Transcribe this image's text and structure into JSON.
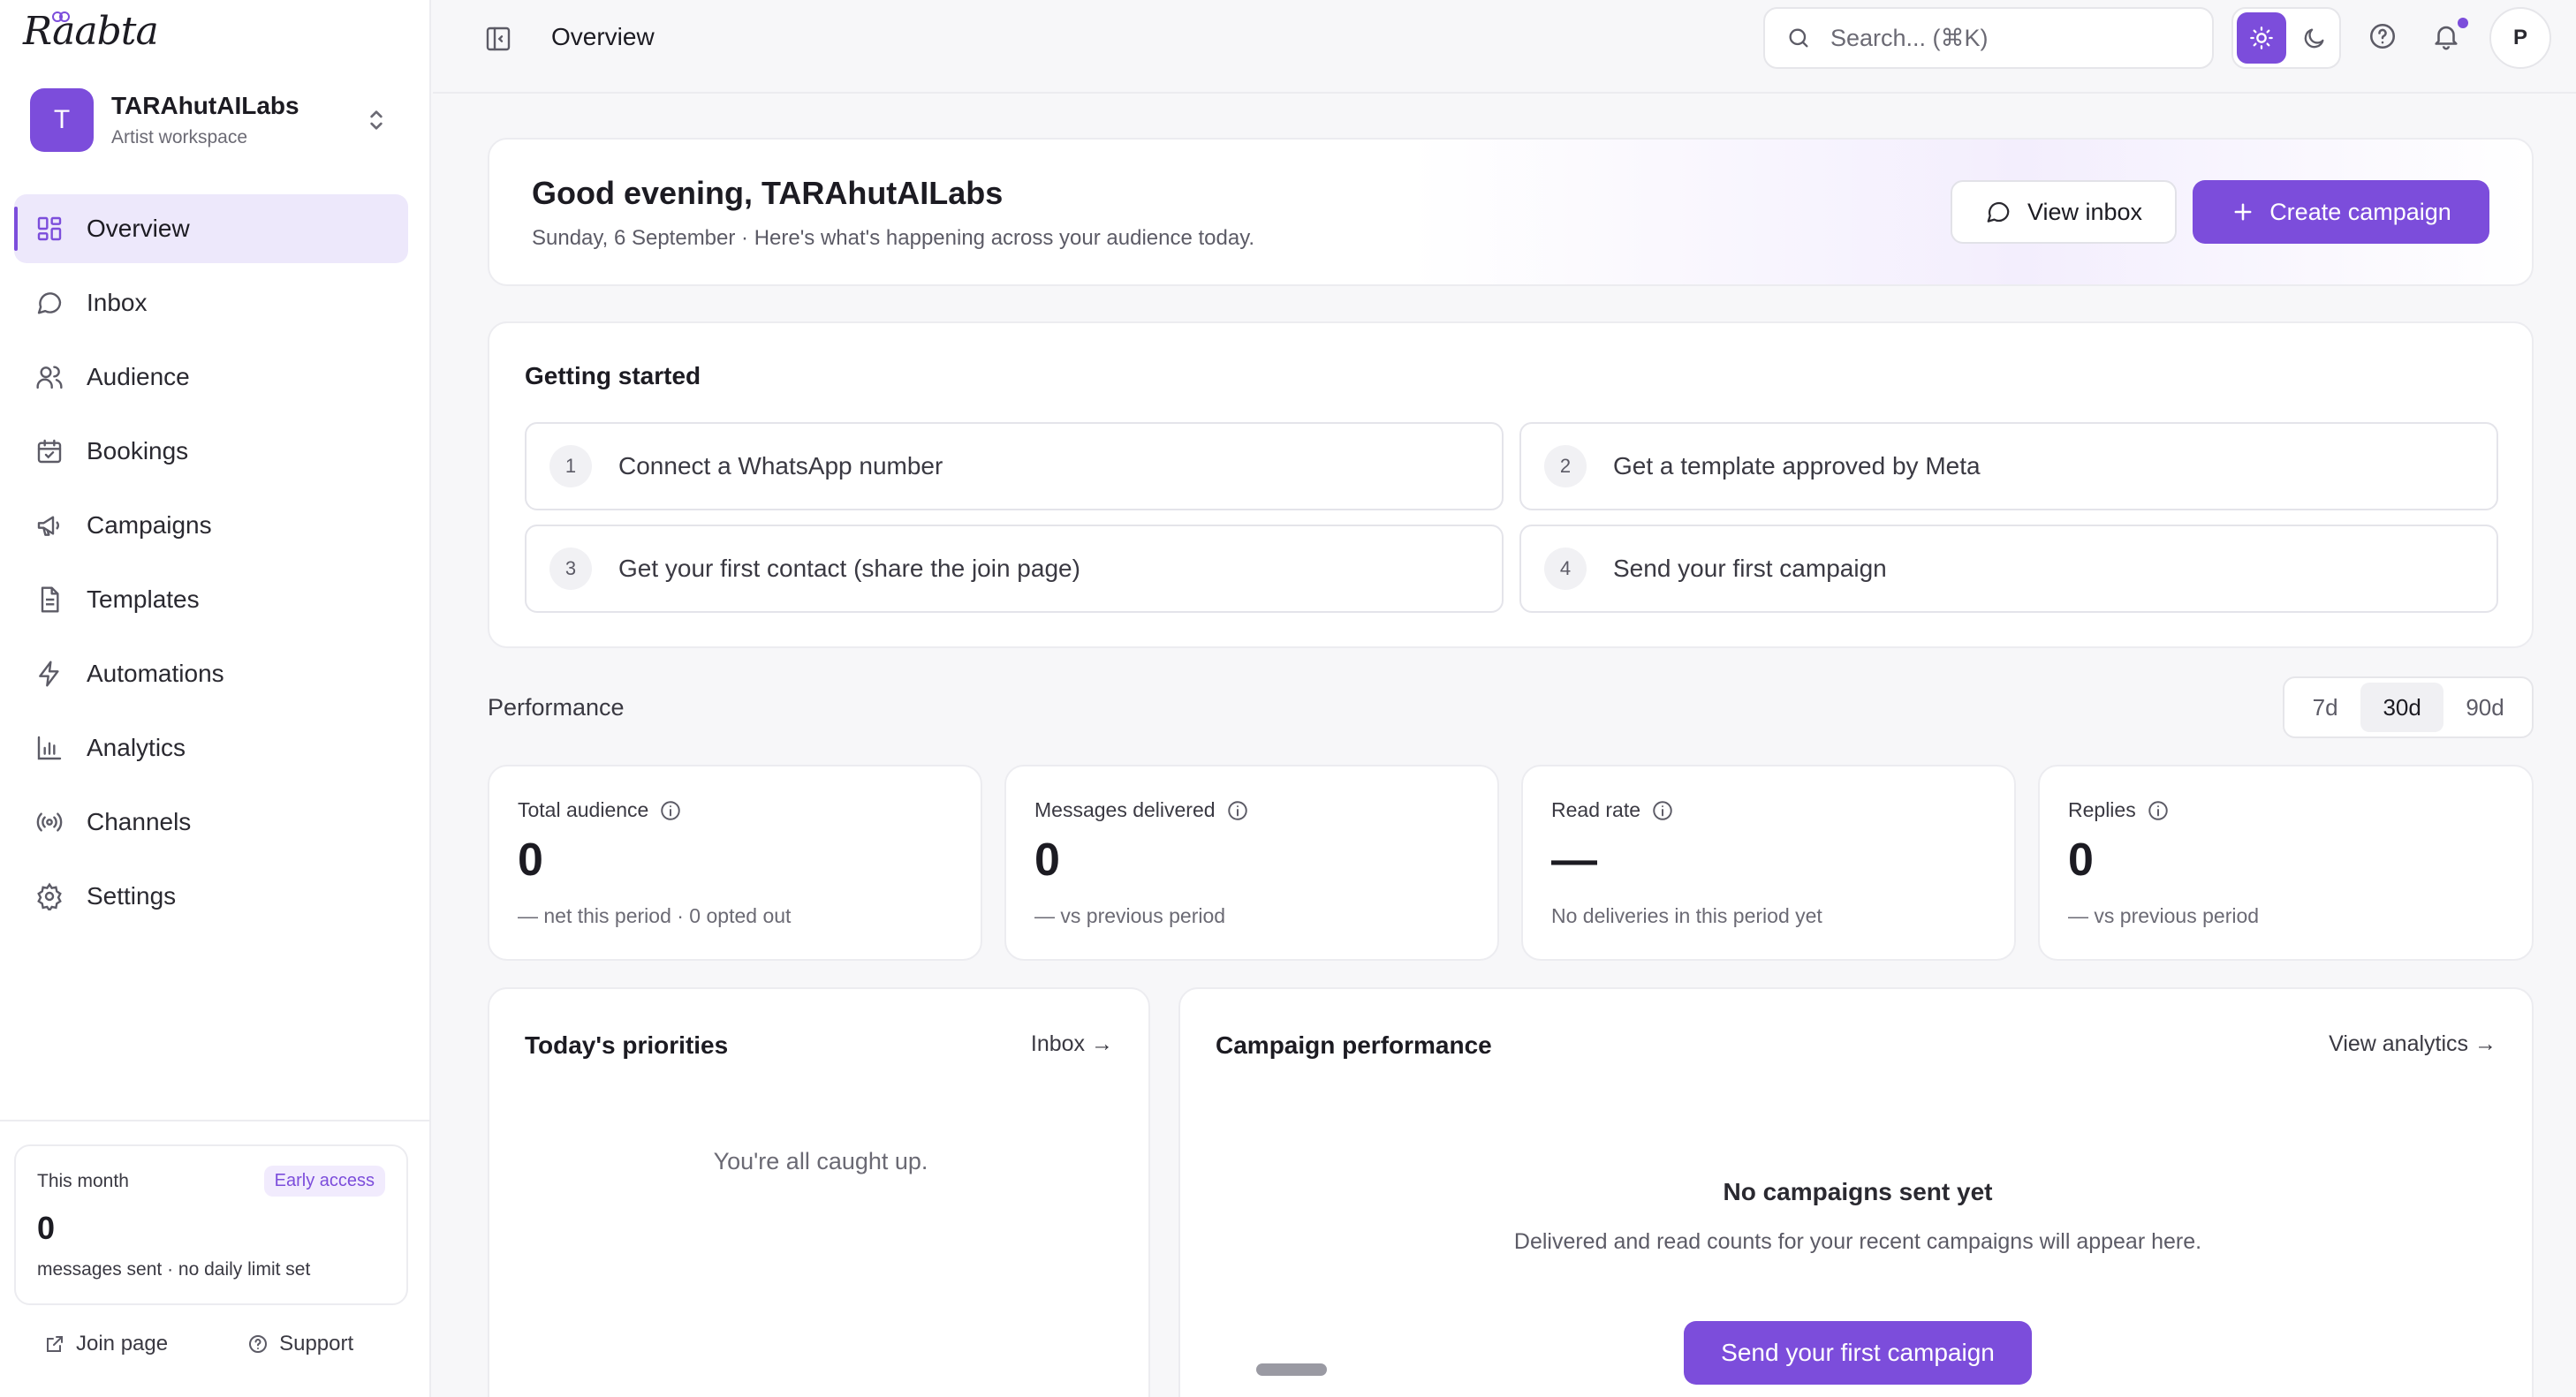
{
  "brand": {
    "logo_text": "Raabta",
    "accent": "#7c4ddb"
  },
  "workspace": {
    "initial": "T",
    "name": "TARAhutAILabs",
    "type": "Artist workspace"
  },
  "sidebar": {
    "items": [
      {
        "label": "Overview",
        "icon": "grid-icon",
        "active": true
      },
      {
        "label": "Inbox",
        "icon": "chat-icon"
      },
      {
        "label": "Audience",
        "icon": "users-icon"
      },
      {
        "label": "Bookings",
        "icon": "calendar-icon"
      },
      {
        "label": "Campaigns",
        "icon": "megaphone-icon"
      },
      {
        "label": "Templates",
        "icon": "document-icon"
      },
      {
        "label": "Automations",
        "icon": "lightning-icon"
      },
      {
        "label": "Analytics",
        "icon": "bar-chart-icon"
      },
      {
        "label": "Channels",
        "icon": "broadcast-icon"
      },
      {
        "label": "Settings",
        "icon": "gear-icon"
      }
    ],
    "usage": {
      "label": "This month",
      "badge": "Early access",
      "value": "0",
      "sub": "messages sent · no daily limit set"
    },
    "footer": {
      "join": "Join page",
      "support": "Support"
    }
  },
  "topbar": {
    "title": "Overview",
    "search_placeholder": "Search... (⌘K)",
    "user_initial": "P"
  },
  "greeting": {
    "title": "Good evening, TARAhutAILabs",
    "subtitle": "Sunday, 6 September · Here's what's happening across your audience today.",
    "view_inbox": "View inbox",
    "create_campaign": "Create campaign"
  },
  "getting_started": {
    "title": "Getting started",
    "steps": [
      {
        "num": "1",
        "label": "Connect a WhatsApp number"
      },
      {
        "num": "2",
        "label": "Get a template approved by Meta"
      },
      {
        "num": "3",
        "label": "Get your first contact (share the join page)"
      },
      {
        "num": "4",
        "label": "Send your first campaign"
      }
    ]
  },
  "performance": {
    "label": "Performance",
    "ranges": [
      "7d",
      "30d",
      "90d"
    ],
    "selected_range": "30d",
    "stats": [
      {
        "label": "Total audience",
        "value": "0",
        "sub": "—  net this period · 0 opted out"
      },
      {
        "label": "Messages delivered",
        "value": "0",
        "sub": "—  vs previous period"
      },
      {
        "label": "Read rate",
        "value": "—",
        "sub": "No deliveries in this period yet"
      },
      {
        "label": "Replies",
        "value": "0",
        "sub": "—  vs previous period"
      }
    ]
  },
  "priorities": {
    "title": "Today's priorities",
    "link": "Inbox →",
    "empty": "You're all caught up."
  },
  "campaign_performance": {
    "title": "Campaign performance",
    "link": "View analytics →",
    "empty_title": "No campaigns sent yet",
    "empty_sub": "Delivered and read counts for your recent campaigns will appear here.",
    "cta": "Send your first campaign"
  }
}
